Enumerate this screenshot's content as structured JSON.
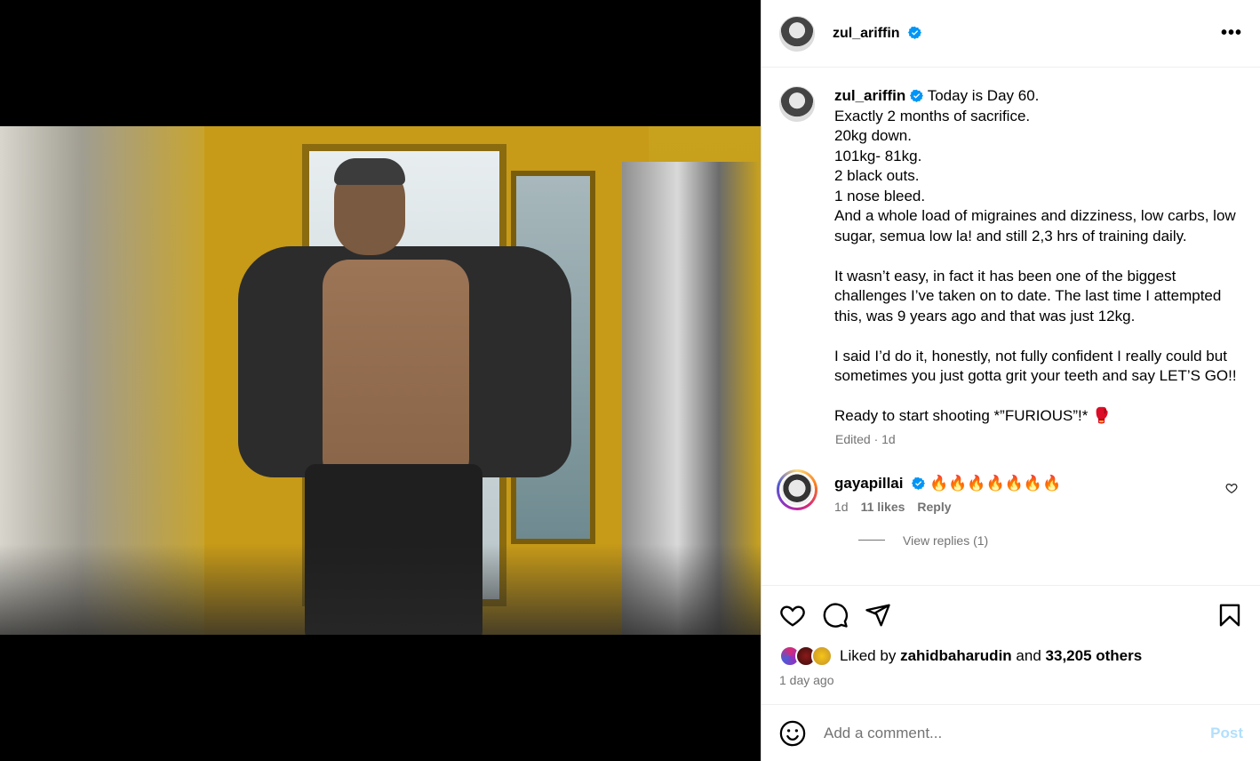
{
  "post": {
    "username": "zul_ariffin",
    "more_label": "•••"
  },
  "caption": {
    "username": "zul_ariffin",
    "text": "Today is Day 60.\nExactly 2 months of sacrifice.\n20kg down.\n101kg- 81kg.\n2 black outs.\n1 nose bleed.\nAnd a whole load of migraines and dizziness, low carbs, low sugar, semua low la! and still 2,3 hrs of training daily.\n\nIt wasn’t easy, in fact it has been one of the biggest challenges I’ve taken on to date. The last time I attempted this, was 9 years ago and that was just 12kg.\n\nI said I’d do it, honestly, not fully confident I really could but sometimes you just gotta grit your teeth and say LET’S GO!!\n\nReady to start shooting *”FURIOUS”!* 🥊",
    "meta": "Edited · 1d"
  },
  "comment": {
    "username": "gayapillai",
    "text": "🔥🔥🔥🔥🔥🔥🔥",
    "age": "1d",
    "likes": "11 likes",
    "reply": "Reply",
    "view_replies": "View replies (1)"
  },
  "likes": {
    "prefix": "Liked by",
    "liker": "zahidbaharudin",
    "conj": "and",
    "others": "33,205 others",
    "time": "1 day ago"
  },
  "add_comment": {
    "placeholder": "Add a comment...",
    "post_label": "Post"
  },
  "colors": {
    "verified": "#0095f6",
    "post_disabled": "#b2dffc",
    "secondary_text": "#737373"
  },
  "icons": [
    "more-icon",
    "verified-icon",
    "heart-icon",
    "comment-icon",
    "share-icon",
    "save-icon",
    "emoji-icon"
  ]
}
